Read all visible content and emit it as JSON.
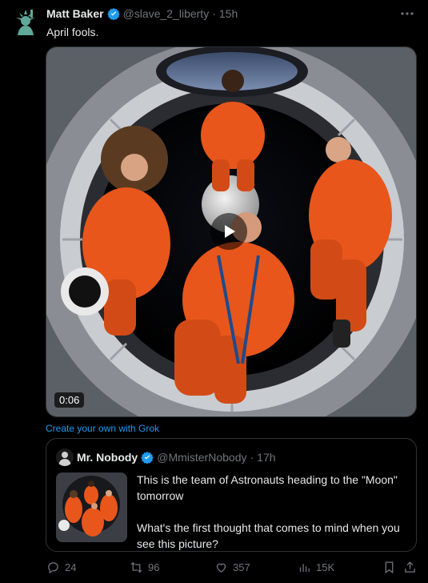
{
  "post": {
    "author_name": "Matt Baker",
    "handle": "@slave_2_liberty",
    "separator": "·",
    "time": "15h",
    "text": "April fools.",
    "more_icon": "more-horizontal-icon",
    "verified_icon": "verified-badge-icon"
  },
  "media": {
    "duration": "0:06",
    "play_icon": "play-icon"
  },
  "grok_link": "Create your own with Grok",
  "quote": {
    "author_name": "Mr. Nobody",
    "handle": "@MmisterNobody",
    "separator": "·",
    "time": "17h",
    "text_line1": "This is the team of Astronauts heading to the \"Moon\" tomorrow",
    "text_line2": "What's the first thought that comes to mind when you see this picture?"
  },
  "actions": {
    "replies": "24",
    "reposts": "96",
    "likes": "357",
    "views": "15K"
  },
  "colors": {
    "accent": "#1d9bf0",
    "muted": "#71767b",
    "border": "#2f3336",
    "background": "#000000",
    "suit_orange": "#e8561c"
  }
}
